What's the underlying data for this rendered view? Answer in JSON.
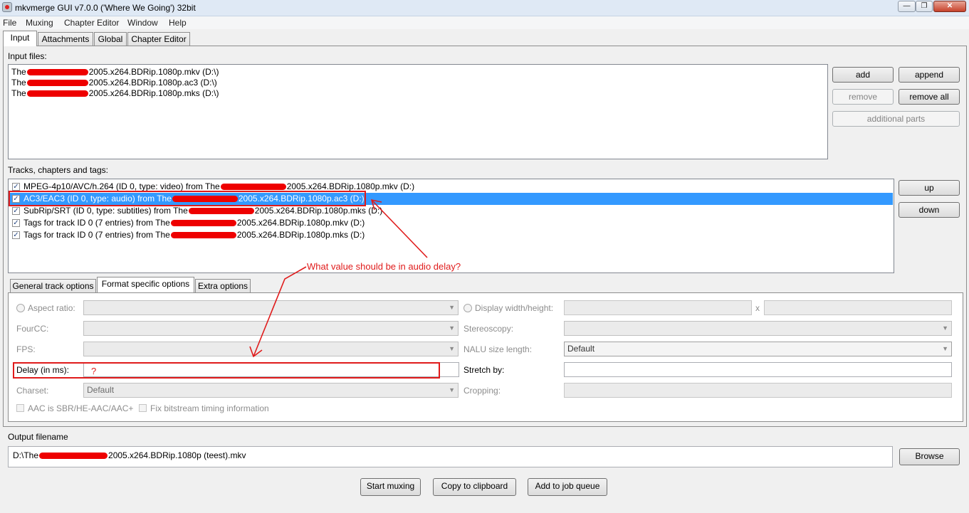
{
  "window": {
    "title": "mkvmerge GUI v7.0.0 ('Where We Going') 32bit"
  },
  "menu": [
    "File",
    "Muxing",
    "Chapter Editor",
    "Window",
    "Help"
  ],
  "main_tabs": [
    "Input",
    "Attachments",
    "Global",
    "Chapter Editor"
  ],
  "input_files": {
    "label": "Input files:",
    "items": [
      {
        "prefix": "The",
        "suffix": "2005.x264.BDRip.1080p.mkv (D:\\)"
      },
      {
        "prefix": "The",
        "suffix": "2005.x264.BDRip.1080p.ac3 (D:\\)"
      },
      {
        "prefix": "The",
        "suffix": "2005.x264.BDRip.1080p.mks (D:\\)"
      }
    ],
    "buttons": {
      "add": "add",
      "append": "append",
      "remove": "remove",
      "remove_all": "remove all",
      "additional_parts": "additional parts"
    }
  },
  "tracks": {
    "label": "Tracks, chapters and tags:",
    "items": [
      {
        "prefix": "MPEG-4p10/AVC/h.264 (ID 0, type: video) from The",
        "suffix": "2005.x264.BDRip.1080p.mkv (D:)"
      },
      {
        "prefix": "AC3/EAC3 (ID 0, type: audio) from The",
        "suffix": "2005.x264.BDRip.1080p.ac3 (D:)"
      },
      {
        "prefix": "SubRip/SRT (ID 0, type: subtitles) from The",
        "suffix": "2005.x264.BDRip.1080p.mks (D:)"
      },
      {
        "prefix": "Tags for track ID 0 (7 entries) from The",
        "suffix": "2005.x264.BDRip.1080p.mkv (D:)"
      },
      {
        "prefix": "Tags for track ID 0 (7 entries) from The",
        "suffix": "2005.x264.BDRip.1080p.mks (D:)"
      }
    ],
    "buttons": {
      "up": "up",
      "down": "down"
    }
  },
  "sub_tabs": [
    "General track options",
    "Format specific options",
    "Extra options"
  ],
  "format_options": {
    "aspect_ratio": "Aspect ratio:",
    "display_wh": "Display width/height:",
    "x_sep": "x",
    "fourcc": "FourCC:",
    "stereoscopy": "Stereoscopy:",
    "fps": "FPS:",
    "nalu": "NALU size length:",
    "nalu_value": "Default",
    "delay": "Delay (in ms):",
    "delay_value": "?",
    "stretch": "Stretch by:",
    "charset": "Charset:",
    "charset_value": "Default",
    "cropping": "Cropping:",
    "aac_sbr": "AAC is SBR/HE-AAC/AAC+",
    "fix_bitstream": "Fix bitstream timing information"
  },
  "output": {
    "label": "Output filename",
    "prefix": "D:\\The",
    "suffix": "2005.x264.BDRip.1080p (teest).mkv",
    "browse": "Browse"
  },
  "actions": {
    "start": "Start muxing",
    "copy": "Copy to clipboard",
    "queue": "Add to job queue"
  },
  "annotation": {
    "text": "What value should be in audio delay?",
    "color": "#e01b1b"
  },
  "colors": {
    "selection": "#3399ff",
    "annotation": "#e01b1b"
  }
}
